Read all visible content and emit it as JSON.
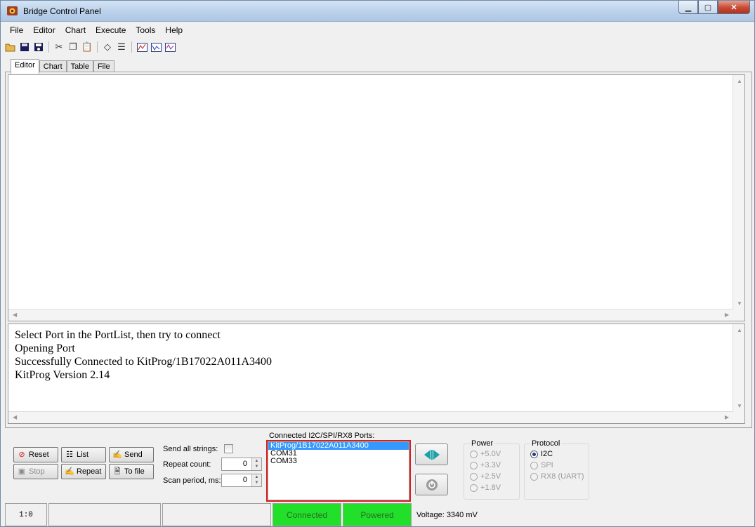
{
  "window": {
    "title": "Bridge Control Panel"
  },
  "menu": [
    "File",
    "Editor",
    "Chart",
    "Execute",
    "Tools",
    "Help"
  ],
  "tabs": [
    "Editor",
    "Chart",
    "Table",
    "File"
  ],
  "log": {
    "lines": [
      "Select Port in the PortList, then try to connect",
      "Opening Port",
      "Successfully Connected to KitProg/1B17022A011A3400",
      "KitProg Version 2.14"
    ]
  },
  "buttons": {
    "reset": "Reset",
    "list": "List",
    "send": "Send",
    "stop": "Stop",
    "repeat": "Repeat",
    "to_file": "To file"
  },
  "options": {
    "send_all_label": "Send all strings:",
    "repeat_count_label": "Repeat count:",
    "repeat_count_value": "0",
    "scan_period_label": "Scan period, ms:",
    "scan_period_value": "0"
  },
  "ports": {
    "label": "Connected I2C/SPI/RX8 Ports:",
    "items": [
      "KitProg/1B17022A011A3400",
      "COM31",
      "COM33"
    ],
    "selected": "KitProg/1B17022A011A3400"
  },
  "power": {
    "title": "Power",
    "options": [
      "+5.0V",
      "+3.3V",
      "+2.5V",
      "+1.8V"
    ]
  },
  "protocol": {
    "title": "Protocol",
    "options": [
      "I2C",
      "SPI",
      "RX8 (UART)"
    ],
    "selected": "I2C"
  },
  "status": {
    "position": "1:0",
    "connected": "Connected",
    "powered": "Powered",
    "voltage": "Voltage: 3340 mV",
    "green": "#22e02a"
  },
  "colors": {
    "highlight": "#d32020",
    "selection": "#3399ff"
  }
}
